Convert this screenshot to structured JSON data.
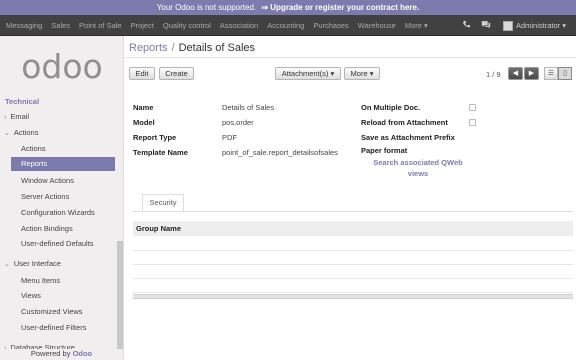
{
  "banner": {
    "text": "Your Odoo is not supported.",
    "link": "⇒ Upgrade or register your contract here."
  },
  "topmenu": [
    "Messaging",
    "Sales",
    "Point of Sale",
    "Project",
    "Quality control",
    "Association",
    "Accounting",
    "Purchases",
    "Warehouse",
    "More ▾"
  ],
  "topright": {
    "user": "Administrator ▾"
  },
  "sidebar": {
    "logo": "odoo",
    "section": "Technical",
    "email": "Email",
    "actions": "Actions",
    "action_items": [
      "Actions",
      "Reports",
      "Window Actions",
      "Server Actions",
      "Configuration Wizards",
      "Action Bindings",
      "User-defined Defaults"
    ],
    "user_interface": "User Interface",
    "ui_items": [
      "Menu Items",
      "Views",
      "Customized Views",
      "User-defined Filters"
    ],
    "database_structure": "Database Structure",
    "powered_prefix": "Powered by",
    "powered_brand": "Odoo"
  },
  "breadcrumb": {
    "parent": "Reports",
    "separator": "/",
    "current": "Details of Sales"
  },
  "buttons": {
    "edit": "Edit",
    "create": "Create",
    "attachments": "Attachment(s) ▾",
    "more": "More ▾"
  },
  "pager": "1 / 9",
  "form": {
    "name_label": "Name",
    "name_value": "Details of Sales",
    "model_label": "Model",
    "model_value": "pos.order",
    "type_label": "Report Type",
    "type_value": "PDF",
    "template_label": "Template Name",
    "template_value": "point_of_sale.report_detailsofsales",
    "multi_label": "On Multiple Doc.",
    "reload_label": "Reload from Attachment",
    "prefix_label": "Save as Attachment Prefix",
    "paper_label": "Paper format",
    "qweb_link": "Search associated QWeb views"
  },
  "tabs": [
    "Security"
  ],
  "grid": {
    "header": "Group Name"
  }
}
